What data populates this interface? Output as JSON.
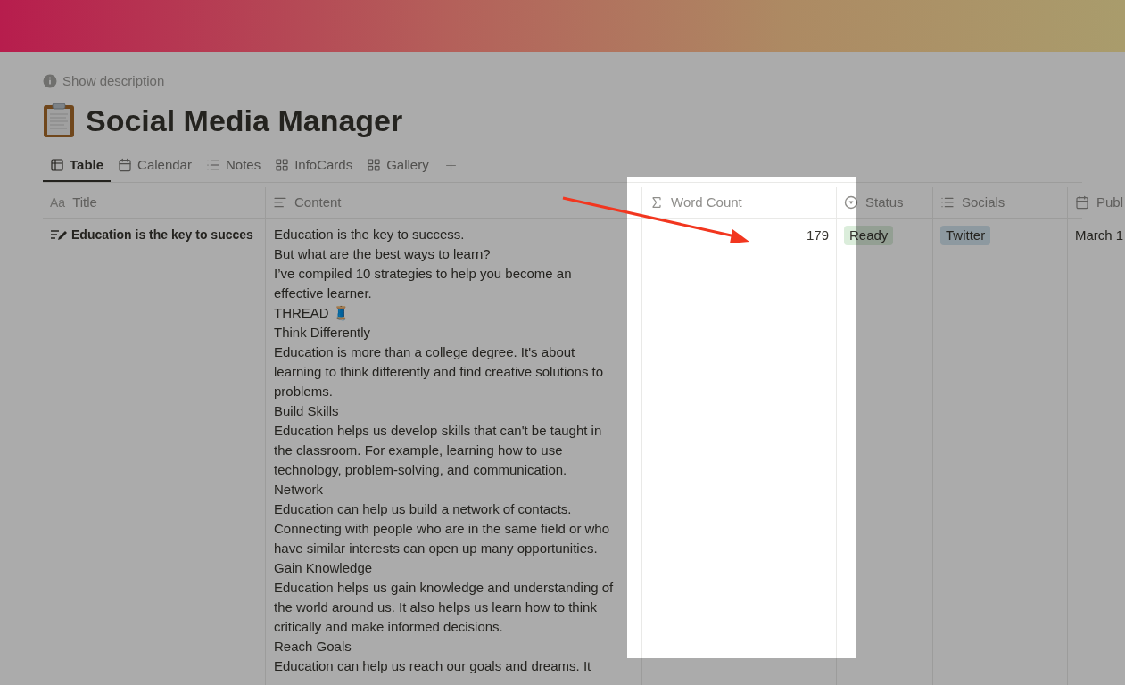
{
  "description_toggle": "Show description",
  "page": {
    "title": "Social Media Manager"
  },
  "views": [
    {
      "label": "Table",
      "selected": true
    },
    {
      "label": "Calendar",
      "selected": false
    },
    {
      "label": "Notes",
      "selected": false
    },
    {
      "label": "InfoCards",
      "selected": false
    },
    {
      "label": "Gallery",
      "selected": false
    }
  ],
  "table": {
    "columns": [
      {
        "label": "Title",
        "glyph": "Aa"
      },
      {
        "label": "Content"
      },
      {
        "label": "Word Count"
      },
      {
        "label": "Status"
      },
      {
        "label": "Socials"
      },
      {
        "label": "Publ"
      }
    ],
    "rows": [
      {
        "title": "Education is the key to succes",
        "content": [
          "Education is the key to success.",
          "But what are the best ways to learn?",
          "I’ve compiled 10 strategies to help you become an",
          "effective learner.",
          "THREAD 🧵",
          "Think Differently",
          "Education is more than a college degree. It's about",
          "learning to think differently and find creative solutions to",
          "problems.",
          "Build Skills",
          "Education helps us develop skills that can't be taught in",
          "the classroom. For example, learning how to use",
          "technology, problem-solving, and communication.",
          "Network",
          "Education can help us build a network of contacts.",
          "Connecting with people who are in the same field or who",
          "have similar interests can open up many opportunities.",
          "Gain Knowledge",
          "Education helps us gain knowledge and understanding of",
          "the world around us. It also helps us learn how to think",
          "critically and make informed decisions.",
          "Reach Goals",
          "Education can help us reach our goals and dreams. It"
        ],
        "word_count": "179",
        "status": "Ready",
        "socials": [
          "Twitter"
        ],
        "publish_date": "March 1"
      }
    ]
  }
}
